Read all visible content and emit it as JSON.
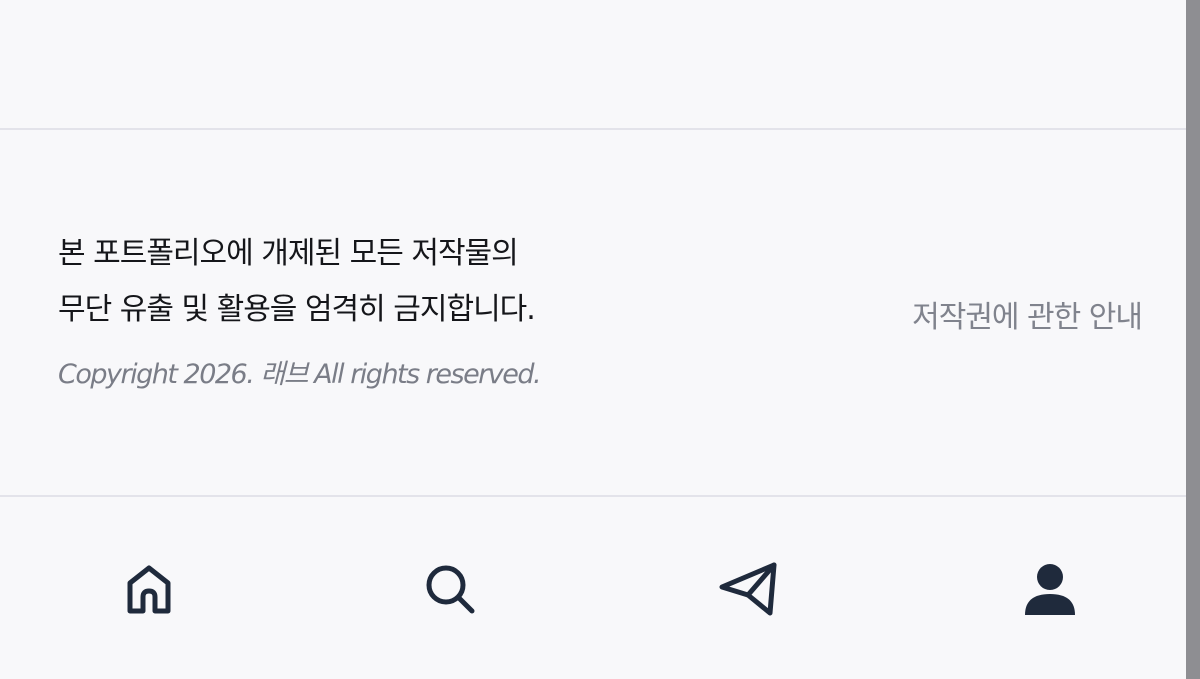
{
  "footer": {
    "notice_line1": "본 포트폴리오에 개제된 모든 저작물의",
    "notice_line2": "무단 유출 및 활용을 엄격히 금지합니다.",
    "copyright": "Copyright 2026. 래브 All rights reserved.",
    "copyright_link": "저작권에 관한 안내"
  },
  "bottom_nav": {
    "items": [
      {
        "name": "home",
        "icon": "home-icon"
      },
      {
        "name": "search",
        "icon": "search-icon"
      },
      {
        "name": "send",
        "icon": "send-icon"
      },
      {
        "name": "profile",
        "icon": "user-icon"
      }
    ]
  },
  "colors": {
    "background": "#f8f8fa",
    "divider": "#e3e3ea",
    "text_primary": "#15161a",
    "text_muted": "#7a7d87",
    "icon": "#1f2a3c"
  }
}
